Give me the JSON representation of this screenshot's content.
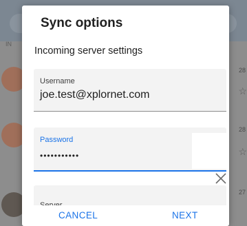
{
  "background": {
    "snippet": "IN",
    "rows": [
      {
        "date": "28",
        "star": "☆"
      },
      {
        "date": "28",
        "star": "☆"
      },
      {
        "date": "27",
        "star": ""
      }
    ]
  },
  "dialog": {
    "title": "Sync options",
    "subtitle": "Incoming server settings",
    "username": {
      "label": "Username",
      "value": "joe.test@xplornet.com"
    },
    "password": {
      "label": "Password",
      "value": "•••••••••••"
    },
    "server": {
      "label": "Server"
    },
    "cancel_label": "CANCEL",
    "next_label": "NEXT"
  },
  "colors": {
    "accent": "#1a73e8",
    "dim": "#8d8d8d"
  }
}
